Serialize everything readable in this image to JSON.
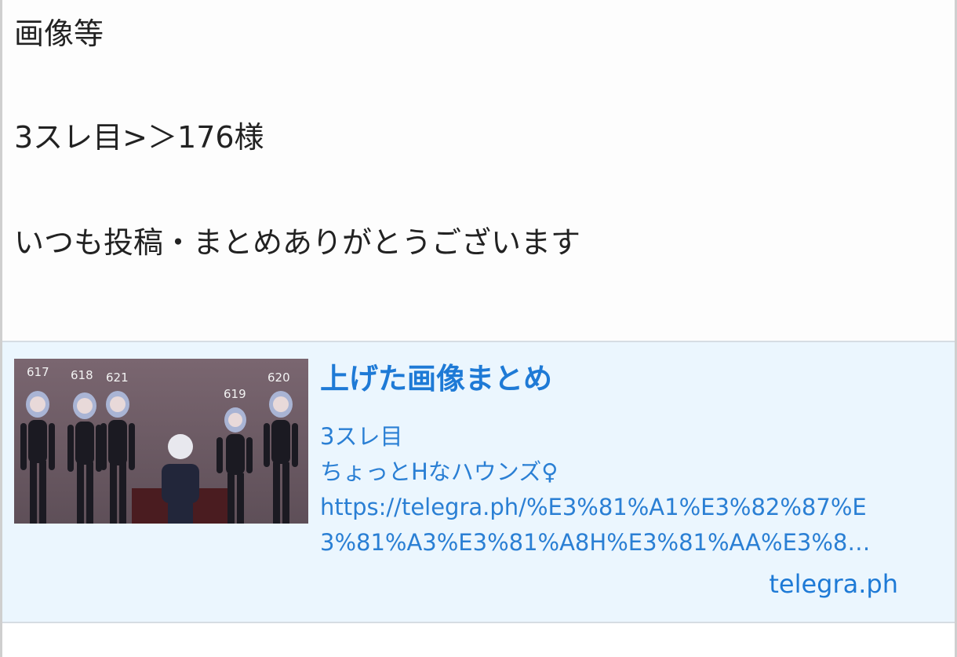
{
  "post": {
    "lines": [
      "画像等",
      "3スレ目>＞176様",
      "いつも投稿・まとめありがとうございます"
    ]
  },
  "link_card": {
    "title": "上げた画像まとめ",
    "description_lines": [
      "3スレ目",
      "ちょっとHなハウンズ♀",
      "https://telegra.ph/%E3%81%A1%E3%82%87%E",
      "3%81%A3%E3%81%A8H%E3%81%AA%E3%8…"
    ],
    "domain": "telegra.ph",
    "thumbnail_labels": [
      "617",
      "618",
      "621",
      "619",
      "620"
    ],
    "colors": {
      "card_background": "#ebf6fe",
      "link_blue": "#1e7ad6",
      "thumbnail_background": "#6f5d66"
    }
  }
}
